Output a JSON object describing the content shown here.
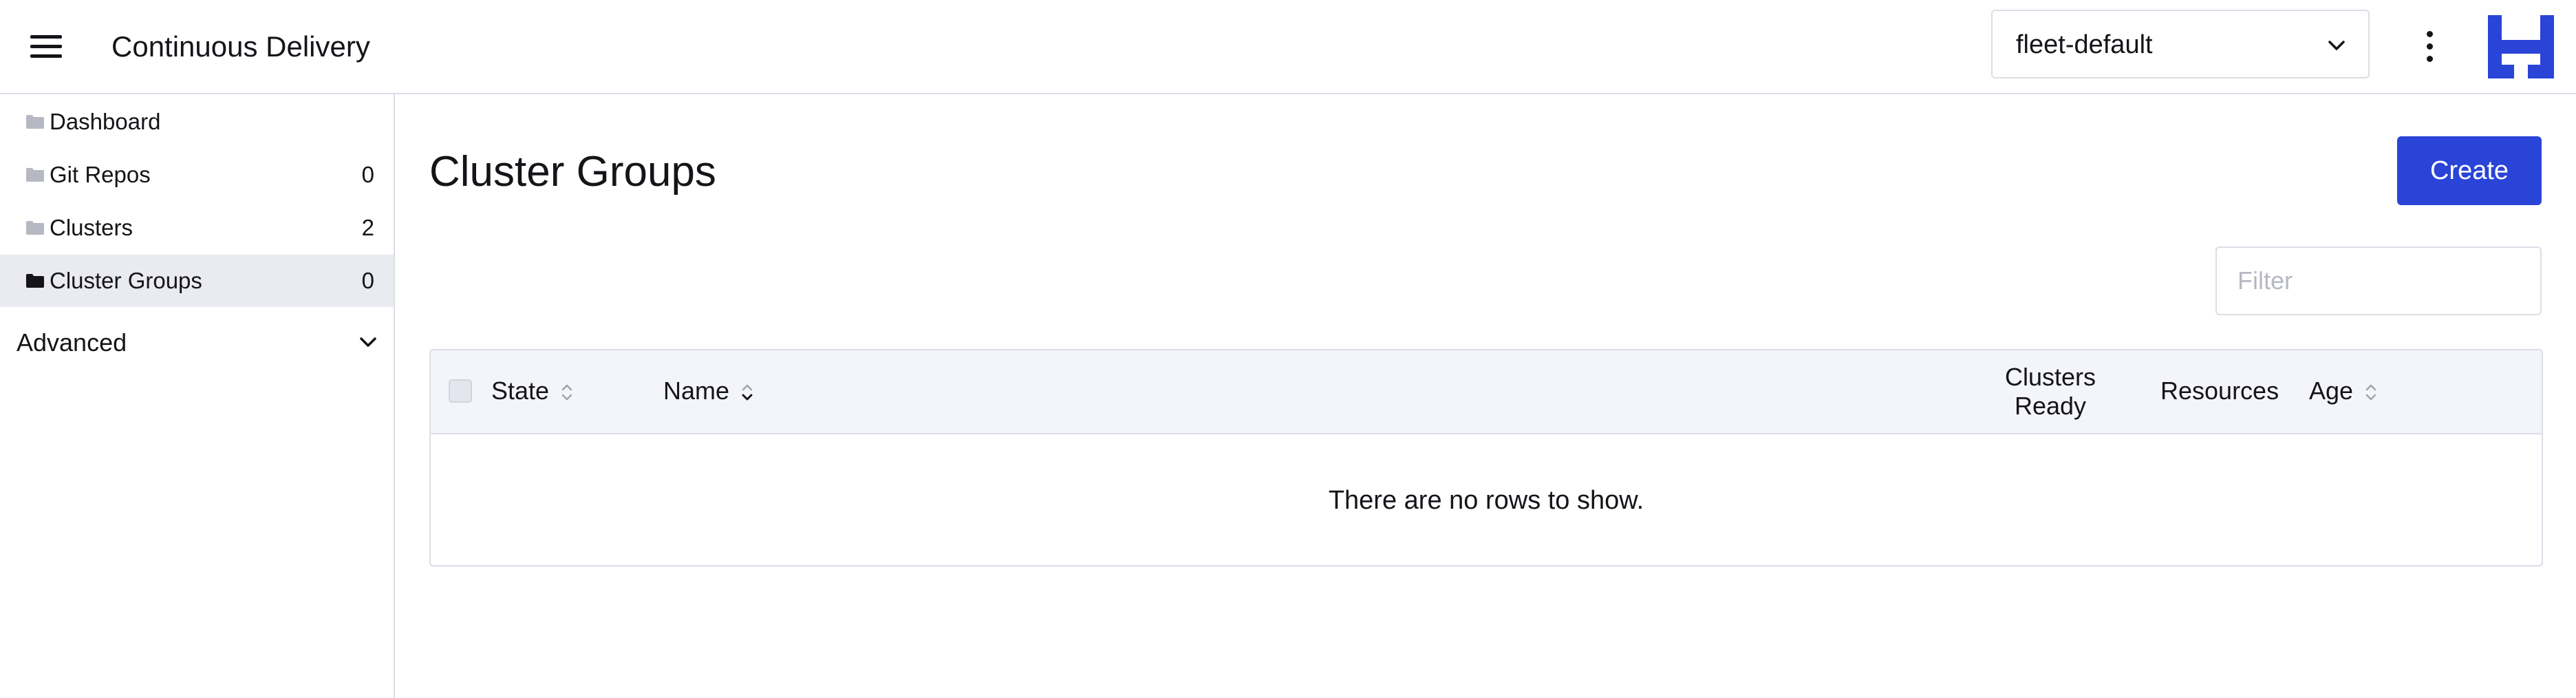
{
  "header": {
    "app_title": "Continuous Delivery",
    "namespace_selected": "fleet-default"
  },
  "sidebar": {
    "items": [
      {
        "label": "Dashboard",
        "count": ""
      },
      {
        "label": "Git Repos",
        "count": "0"
      },
      {
        "label": "Clusters",
        "count": "2"
      },
      {
        "label": "Cluster Groups",
        "count": "0",
        "active": true
      }
    ],
    "group_label": "Advanced"
  },
  "main": {
    "title": "Cluster Groups",
    "create_label": "Create",
    "filter_placeholder": "Filter",
    "table": {
      "columns": [
        "State",
        "Name",
        "Clusters",
        "Ready",
        "Resources",
        "Age"
      ],
      "empty_message": "There are no rows to show."
    }
  },
  "colors": {
    "accent": "#2a44d7",
    "border": "#dcdee7",
    "header_bg": "#f4f5fa",
    "active_nav_bg": "#eaebf0"
  },
  "icons": [
    "hamburger-icon",
    "chevron-down-icon",
    "kebab-menu-icon",
    "folder-icon",
    "sort-icon"
  ]
}
